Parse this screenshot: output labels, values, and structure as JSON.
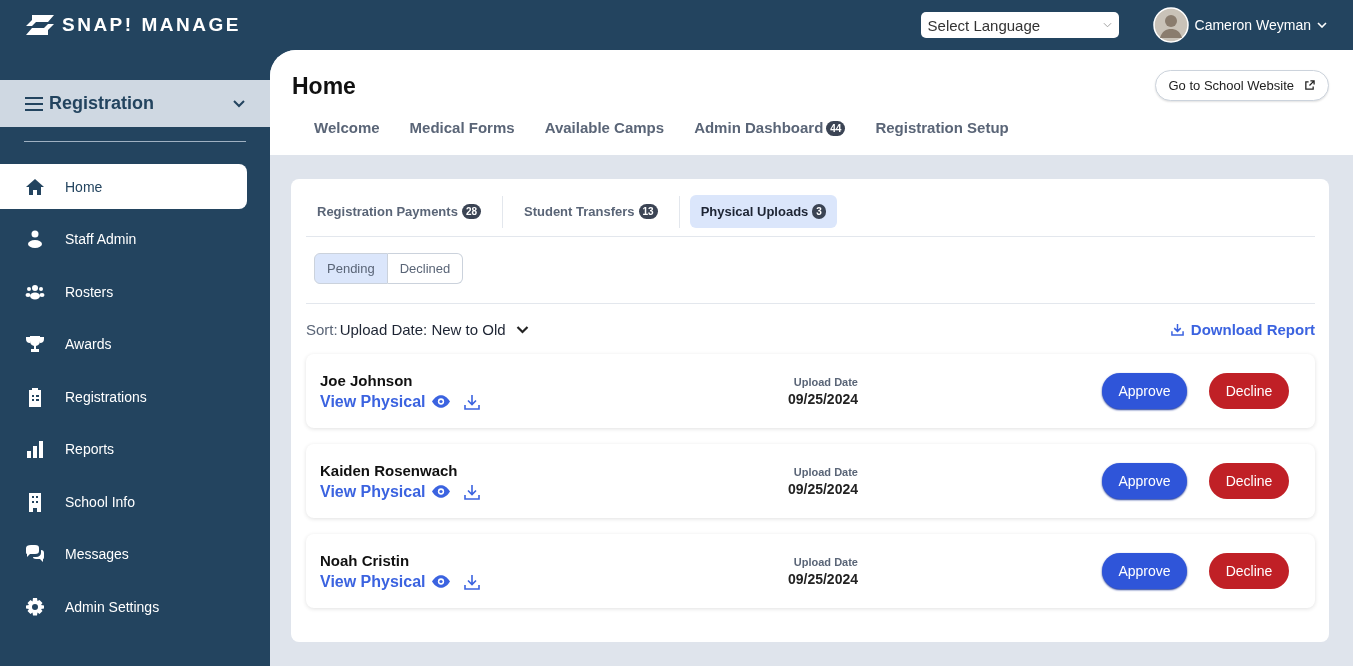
{
  "header": {
    "logo": "SNAP! MANAGE",
    "language_select": {
      "value": "Select Language"
    },
    "user": {
      "name": "Cameron Weyman"
    }
  },
  "sidebar": {
    "section": "Registration",
    "items": [
      {
        "label": "Home",
        "kind": "home",
        "selected": true
      },
      {
        "label": "Staff Admin",
        "kind": "person",
        "selected": false
      },
      {
        "label": "Rosters",
        "kind": "group",
        "selected": false
      },
      {
        "label": "Awards",
        "kind": "trophy",
        "selected": false
      },
      {
        "label": "Registrations",
        "kind": "clipboard",
        "selected": false
      },
      {
        "label": "Reports",
        "kind": "chart",
        "selected": false
      },
      {
        "label": "School Info",
        "kind": "building",
        "selected": false
      },
      {
        "label": "Messages",
        "kind": "chat",
        "selected": false
      },
      {
        "label": "Admin Settings",
        "kind": "gear",
        "selected": false
      }
    ]
  },
  "page": {
    "title": "Home",
    "website_button": "Go to School Website",
    "tabs": [
      {
        "label": "Welcome"
      },
      {
        "label": "Medical Forms"
      },
      {
        "label": "Available Camps"
      },
      {
        "label": "Admin Dashboard",
        "badge": "44"
      },
      {
        "label": "Registration Setup"
      }
    ],
    "subtabs": [
      {
        "label": "Registration Payments",
        "badge": "28",
        "selected": false
      },
      {
        "label": "Student Transfers",
        "badge": "13",
        "selected": false
      },
      {
        "label": "Physical Uploads",
        "badge": "3",
        "selected": true
      }
    ],
    "filters": [
      {
        "label": "Pending",
        "selected": true
      },
      {
        "label": "Declined",
        "selected": false
      }
    ],
    "sort": {
      "label": "Sort:",
      "value": "Upload Date: New to Old"
    },
    "download_report": "Download Report",
    "uploads": [
      {
        "name": "Joe Johnson",
        "link": "View Physical",
        "date_label": "Upload Date",
        "date": "09/25/2024",
        "approve": "Approve",
        "decline": "Decline"
      },
      {
        "name": "Kaiden Rosenwach",
        "link": "View Physical",
        "date_label": "Upload Date",
        "date": "09/25/2024",
        "approve": "Approve",
        "decline": "Decline"
      },
      {
        "name": "Noah Cristin",
        "link": "View Physical",
        "date_label": "Upload Date",
        "date": "09/25/2024",
        "approve": "Approve",
        "decline": "Decline"
      }
    ]
  }
}
